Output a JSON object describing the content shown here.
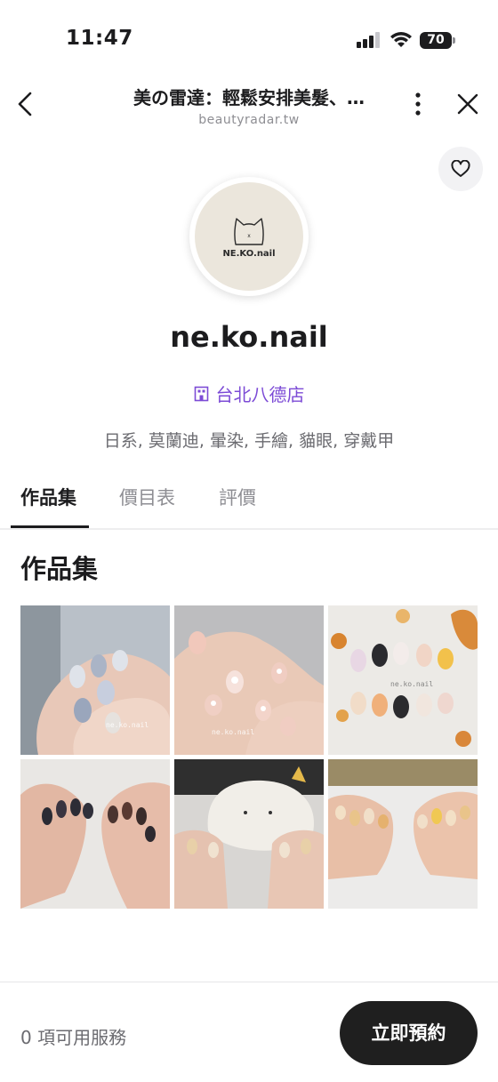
{
  "status_bar": {
    "time": "11:47",
    "battery": "70"
  },
  "nav": {
    "title": "美の雷達：輕鬆安排美髮、…",
    "url": "beautyradar.tw"
  },
  "avatar": {
    "logo_text": "NE.KO.nail"
  },
  "shop": {
    "name": "ne.ko.nail",
    "branch": "台北八德店",
    "tags": "日系, 莫蘭迪, 暈染, 手繪, 貓眼, 穿戴甲"
  },
  "tabs": [
    {
      "label": "作品集",
      "active": true
    },
    {
      "label": "價目表",
      "active": false
    },
    {
      "label": "評價",
      "active": false
    }
  ],
  "portfolio": {
    "title": "作品集",
    "photos": [
      {
        "subject": "nail-photo-blue-gray-smudge",
        "watermark": "ne.ko.nail"
      },
      {
        "subject": "nail-photo-pink-flowers",
        "watermark": "ne.ko.nail"
      },
      {
        "subject": "nail-photo-character-press-ons",
        "watermark": "ne.ko.nail"
      },
      {
        "subject": "nail-photo-dark-cat-eye"
      },
      {
        "subject": "nail-photo-cat-plush"
      },
      {
        "subject": "nail-photo-cute-art"
      }
    ]
  },
  "bottom_bar": {
    "service_count": "0 項可用服務",
    "book_label": "立即預約"
  },
  "colors": {
    "accent": "#7c4bd6",
    "primary_button": "#1f1f1f",
    "muted_text": "#6b6b70"
  },
  "icons": [
    "signal-icon",
    "wifi-icon",
    "battery-icon",
    "back-chevron-icon",
    "more-vertical-icon",
    "close-icon",
    "heart-icon",
    "cat-logo-icon",
    "store-icon"
  ]
}
